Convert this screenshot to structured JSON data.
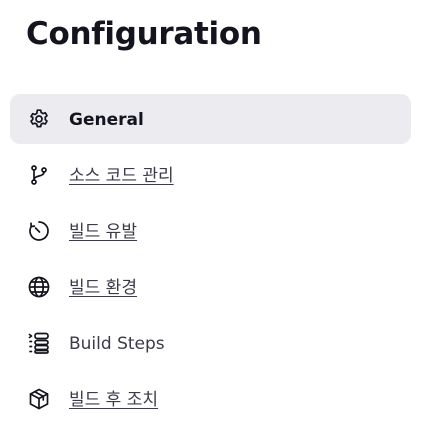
{
  "page": {
    "title": "Configuration"
  },
  "sidebar": {
    "items": [
      {
        "label": "General",
        "icon": "gear-icon",
        "active": true
      },
      {
        "label": "소스 코드 관리",
        "icon": "branch-icon",
        "active": false
      },
      {
        "label": "빌드 유발",
        "icon": "timer-icon",
        "active": false
      },
      {
        "label": "빌드 환경",
        "icon": "globe-icon",
        "active": false
      },
      {
        "label": "Build Steps",
        "icon": "list-steps-icon",
        "active": false
      },
      {
        "label": "빌드 후 조치",
        "icon": "package-icon",
        "active": false
      }
    ]
  },
  "colors": {
    "active_background": "#ececf0",
    "text_primary": "#14141f",
    "text_secondary": "#3a3a4a"
  }
}
